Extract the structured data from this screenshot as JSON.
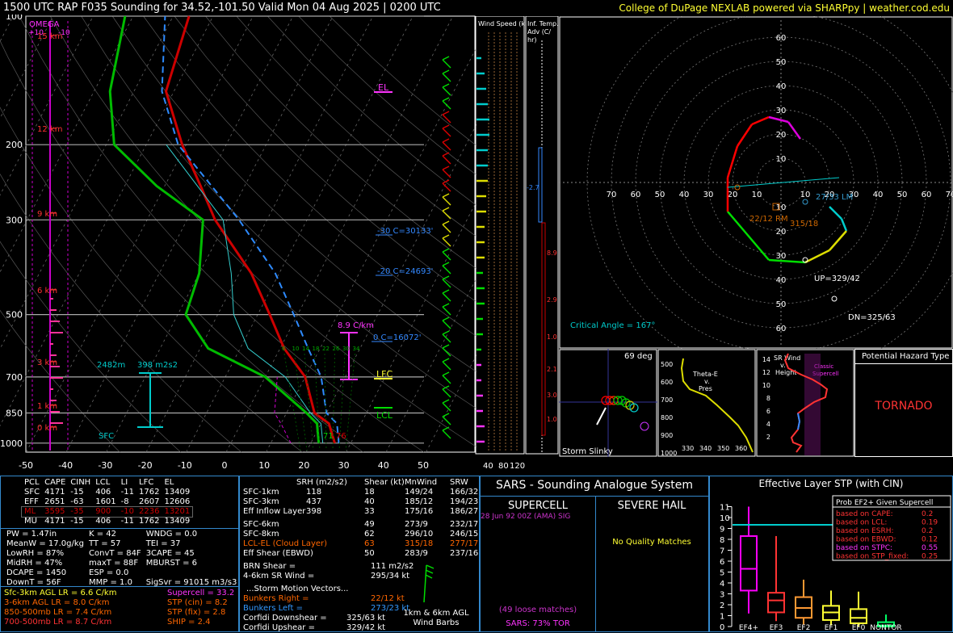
{
  "header": {
    "title": "1500 UTC RAP F035 Sounding for 34.52,-101.50 Valid  Mon 04 Aug 2025 | 0200 UTC",
    "credit": "College of DuPage NEXLAB powered via SHARPpy | weather.cod.edu"
  },
  "skewt": {
    "pressure_ticks": [
      "100",
      "200",
      "300",
      "500",
      "700",
      "850",
      "1000"
    ],
    "temp_ticks": [
      "-50",
      "-40",
      "-30",
      "-20",
      "-10",
      "0",
      "10",
      "20",
      "30",
      "40",
      "50"
    ],
    "height_labels": [
      "15 km",
      "12 km",
      "9 km",
      "6 km",
      "3 km",
      "1 km",
      "0 km"
    ],
    "omega_label": "OMEGA",
    "omega_ticks": [
      "+10",
      "-10"
    ],
    "el": "EL",
    "lfc": "LFC",
    "lcl": "LCL",
    "levels": [
      "-30 C=30133'",
      "-20 C=24693'",
      "0 C=16072'"
    ],
    "lapse": "8.9 C/km",
    "eff_inflow_depth": "2482m",
    "eff_srh": "398 m2s2",
    "sfc": "SFC",
    "surface_temp": "76",
    "surface_dew": "71",
    "mixing_ratios": [
      "6",
      "10",
      "14",
      "18",
      "22",
      "26",
      "30",
      "34"
    ]
  },
  "wind_speed_panel": {
    "title": "Wind Speed (knots)",
    "ticks": [
      "40",
      "80",
      "120"
    ]
  },
  "temp_adv_panel": {
    "title": "Inf. Temp. Adv (C/hr)",
    "values": [
      "-2.7",
      "8.9",
      "2.9",
      "1.0",
      "2.1",
      "3.0",
      "1.0"
    ]
  },
  "hodograph": {
    "ring_labels": [
      "10",
      "20",
      "30",
      "40",
      "50",
      "60",
      "70"
    ],
    "labels": [
      "27/33 LM",
      "22/12 RM",
      "315/18",
      "UP=329/42",
      "DN=325/63"
    ],
    "critical_angle": "Critical Angle = 167°"
  },
  "slinky": {
    "angle": "69 deg",
    "label": "Storm Slinky"
  },
  "theta_panel": {
    "title": "Theta-E v. Pres",
    "pres_ticks": [
      "500",
      "600",
      "700",
      "800",
      "900",
      "1000"
    ],
    "x_ticks": [
      "330",
      "340",
      "350",
      "360"
    ]
  },
  "srwind_panel": {
    "title": "SR Wind v. Height",
    "classic": "Classic Supercell",
    "y_ticks": [
      "14",
      "12",
      "10",
      "8",
      "6",
      "4",
      "2"
    ]
  },
  "hazard": {
    "title": "Potential Hazard Type",
    "value": "TORNADO"
  },
  "thermo_table": {
    "headers": [
      "PCL",
      "CAPE",
      "CINH",
      "LCL",
      "LI",
      "LFC",
      "EL"
    ],
    "rows": [
      [
        "SFC",
        "4171",
        "-15",
        "406",
        "-11",
        "1762",
        "13409"
      ],
      [
        "EFF",
        "2651",
        "-63",
        "1601",
        "-8",
        "2607",
        "12606"
      ],
      [
        "ML",
        "3595",
        "-35",
        "900",
        "-10",
        "2236",
        "13201"
      ],
      [
        "MU",
        "4171",
        "-15",
        "406",
        "-11",
        "1762",
        "13409"
      ]
    ]
  },
  "indices": [
    [
      "PW = 1.47in",
      "K = 42",
      "WNDG = 0.0"
    ],
    [
      "MeanW = 17.0g/kg",
      "TT = 57",
      "TEI = 37"
    ],
    [
      "LowRH = 87%",
      "ConvT = 84F",
      "3CAPE = 45"
    ],
    [
      "MidRH = 47%",
      "maxT = 88F",
      "MBURST = 6"
    ],
    [
      "DCAPE = 1450",
      "ESP = 0.0",
      ""
    ],
    [
      "DownT = 56F",
      "MMP = 1.0",
      "SigSvr = 91015 m3/s3"
    ]
  ],
  "lapse_rates": [
    "Sfc-3km AGL LR = 6.6 C/km",
    "3-6km AGL LR = 8.0 C/km",
    "850-500mb LR = 7.4 C/km",
    "700-500mb LR = 8.7 C/km"
  ],
  "composites": [
    "Supercell = 33.2",
    "STP (cin) = 8.2",
    "STP (fix) = 2.8",
    "SHIP = 2.4"
  ],
  "kinematics": {
    "headers": [
      "SRH (m2/s2)",
      "Shear (kt)",
      "MnWind",
      "SRW"
    ],
    "rows": [
      [
        "SFC-1km",
        "118",
        "18",
        "149/24",
        "166/32"
      ],
      [
        "SFC-3km",
        "437",
        "40",
        "185/12",
        "194/23"
      ],
      [
        "Eff Inflow Layer",
        "398",
        "33",
        "175/16",
        "186/27"
      ],
      [
        "SFC-6km",
        "49",
        "273/9",
        "232/17",
        ""
      ],
      [
        "SFC-8km",
        "62",
        "296/10",
        "246/15",
        ""
      ],
      [
        "LCL-EL (Cloud Layer)",
        "63",
        "315/18",
        "277/17",
        ""
      ],
      [
        "Eff Shear (EBWD)",
        "50",
        "283/9",
        "237/16",
        ""
      ]
    ],
    "brn": [
      "BRN Shear =",
      "111 m2/s2"
    ],
    "sr4_6": [
      "4-6km SR Wind =",
      "295/34 kt"
    ],
    "storm_title": "...Storm Motion Vectors...",
    "motions": [
      [
        "Bunkers Right =",
        "22/12 kt"
      ],
      [
        "Bunkers Left =",
        "273/23 kt"
      ],
      [
        "Corfidi Downshear =",
        "325/63 kt"
      ],
      [
        "Corfidi Upshear =",
        "329/42 kt"
      ]
    ],
    "barbs_label": "1km & 6km AGL Wind Barbs"
  },
  "sars": {
    "title": "SARS - Sounding Analogue System",
    "supercell": "SUPERCELL",
    "hail": "SEVERE HAIL",
    "match": "28 Jun 92 00Z (AMA)  SIG",
    "no_match": "No Quality Matches",
    "loose": "(49 loose matches)",
    "tor": "SARS: 73% TOR"
  },
  "stp_panel": {
    "title": "Effective Layer STP (with CIN)",
    "y_ticks": [
      "0",
      "1",
      "2",
      "3",
      "4",
      "5",
      "6",
      "7",
      "8",
      "9",
      "10",
      "11"
    ],
    "prob_title": "Prob EF2+ Given Supercell",
    "probs": [
      [
        "based on CAPE:",
        "0.2"
      ],
      [
        "based on LCL:",
        "0.19"
      ],
      [
        "based on ESRH:",
        "0.2"
      ],
      [
        "based on EBWD:",
        "0.12"
      ],
      [
        "based on STPC:",
        "0.55"
      ],
      [
        "based on STP_fixed:",
        "0.25"
      ]
    ],
    "categories": [
      "EF4+",
      "EF3",
      "EF2",
      "EF1",
      "EF0",
      "NONTOR"
    ]
  },
  "colors": {
    "title": "#ffff33",
    "temp": "#cc0000",
    "dew": "#00bb00",
    "parcel": "#2e8bff",
    "cyan": "#00cccc",
    "magenta": "#ff00ff",
    "red": "#ff3333"
  },
  "chart_data": [
    {
      "type": "line",
      "title": "Skew-T log-p",
      "x_range": [
        -50,
        50
      ],
      "y_range_mb": [
        1000,
        100
      ],
      "series": [
        {
          "name": "Temperature",
          "points": [
            [
              1000,
              26
            ],
            [
              900,
              22
            ],
            [
              850,
              17
            ],
            [
              700,
              10
            ],
            [
              600,
              1
            ],
            [
              500,
              -7
            ],
            [
              400,
              -17
            ],
            [
              300,
              -33
            ],
            [
              250,
              -41
            ],
            [
              200,
              -51
            ],
            [
              150,
              -62
            ],
            [
              100,
              -66
            ]
          ]
        },
        {
          "name": "Dewpoint",
          "points": [
            [
              1000,
              22
            ],
            [
              900,
              19
            ],
            [
              850,
              15
            ],
            [
              700,
              0
            ],
            [
              600,
              -18
            ],
            [
              500,
              -28
            ],
            [
              400,
              -30
            ],
            [
              300,
              -36
            ],
            [
              250,
              -52
            ],
            [
              200,
              -68
            ],
            [
              150,
              -76
            ],
            [
              100,
              -82
            ]
          ]
        },
        {
          "name": "Parcel",
          "points": [
            [
              1000,
              27
            ],
            [
              900,
              24
            ],
            [
              850,
              20
            ],
            [
              700,
              14
            ],
            [
              600,
              7
            ],
            [
              500,
              -1
            ],
            [
              400,
              -11
            ],
            [
              300,
              -27
            ],
            [
              200,
              -52
            ],
            [
              150,
              -63
            ],
            [
              100,
              -72
            ]
          ]
        }
      ]
    },
    {
      "type": "line",
      "title": "Hodograph",
      "series": [
        {
          "name": "hodo",
          "points": [
            [
              20,
              -10
            ],
            [
              25,
              -15
            ],
            [
              27,
              -20
            ],
            [
              20,
              -28
            ],
            [
              10,
              -33
            ],
            [
              -5,
              -32
            ],
            [
              -22,
              -12
            ],
            [
              -22,
              2
            ],
            [
              -18,
              15
            ],
            [
              -12,
              24
            ],
            [
              -5,
              27
            ],
            [
              3,
              25
            ],
            [
              8,
              18
            ]
          ]
        }
      ]
    },
    {
      "type": "bar",
      "title": "Effective Layer STP (with CIN)",
      "categories": [
        "EF4+",
        "EF3",
        "EF2",
        "EF1",
        "EF0",
        "NONTOR"
      ],
      "series": [
        {
          "name": "p10",
          "values": [
            1.2,
            0.5,
            0.2,
            0.1,
            0.0,
            0.0
          ]
        },
        {
          "name": "p25",
          "values": [
            3.3,
            1.3,
            0.8,
            0.6,
            0.3,
            0.0
          ]
        },
        {
          "name": "median",
          "values": [
            5.3,
            2.4,
            1.7,
            1.3,
            0.8,
            0.1
          ]
        },
        {
          "name": "p75",
          "values": [
            8.3,
            3.1,
            2.7,
            1.9,
            1.6,
            0.4
          ]
        },
        {
          "name": "p90",
          "values": [
            11,
            8.3,
            4.3,
            3.3,
            3.2,
            1.1
          ]
        }
      ],
      "ylim": [
        0,
        11
      ]
    }
  ]
}
